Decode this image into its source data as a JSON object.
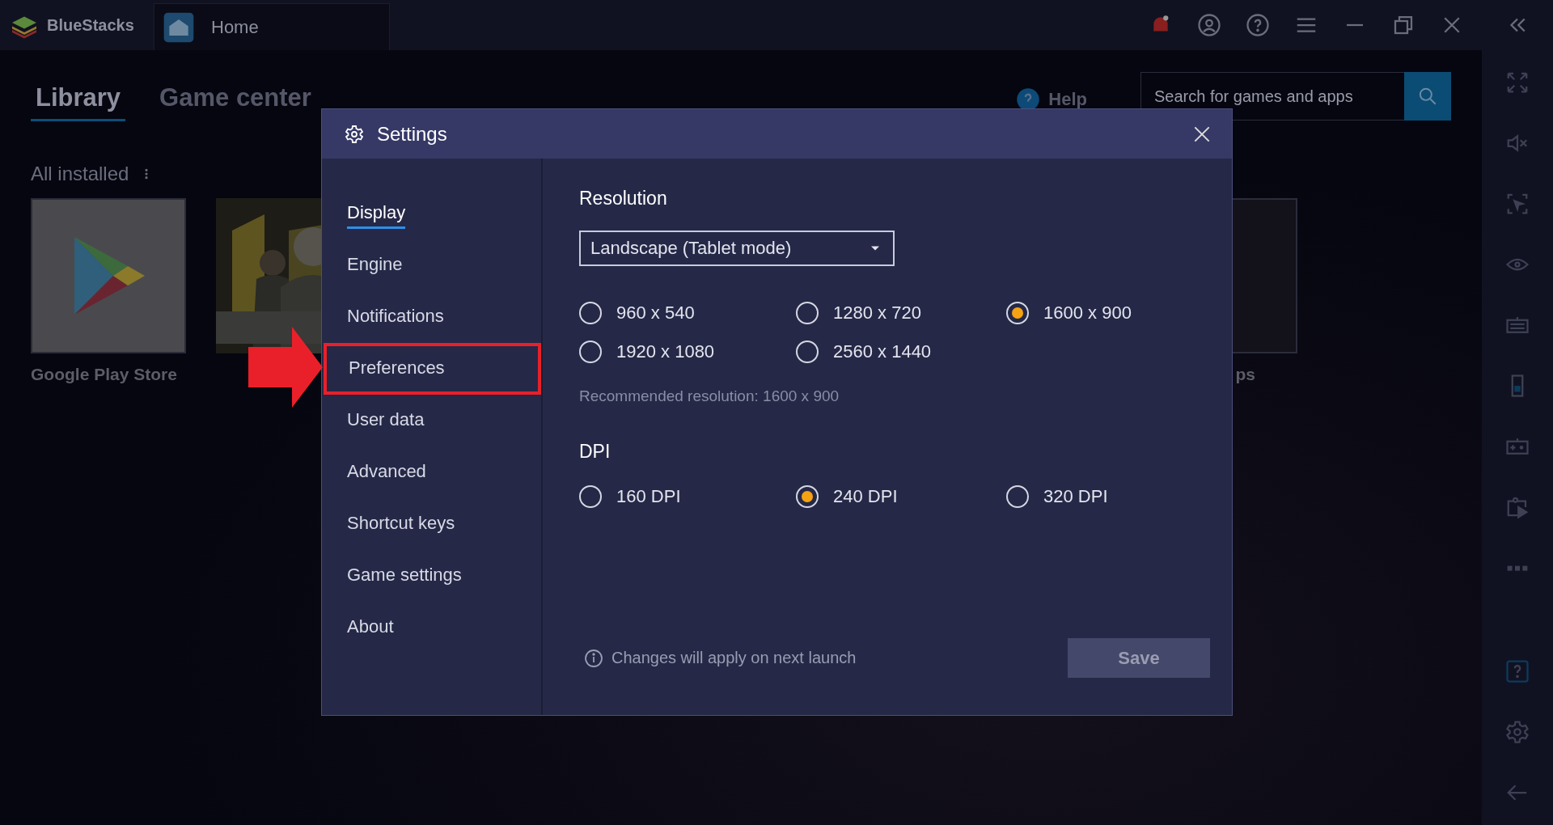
{
  "app": {
    "name": "BlueStacks"
  },
  "tabs": [
    {
      "label": "Home",
      "selected": true
    }
  ],
  "library": {
    "tabs": [
      {
        "label": "Library",
        "selected": true
      },
      {
        "label": "Game center",
        "selected": false
      }
    ],
    "help": "Help",
    "search": {
      "placeholder": "Search for games and apps"
    },
    "section": "All installed",
    "apps": [
      {
        "kind": "play",
        "name": "Google Play Store"
      },
      {
        "kind": "picture"
      },
      {
        "kind": "system",
        "name": "ps"
      }
    ]
  },
  "settings": {
    "title": "Settings",
    "nav": [
      {
        "label": "Display",
        "selected": true,
        "annotated": false
      },
      {
        "label": "Engine",
        "selected": false,
        "annotated": false
      },
      {
        "label": "Notifications",
        "selected": false,
        "annotated": false
      },
      {
        "label": "Preferences",
        "selected": false,
        "annotated": true
      },
      {
        "label": "User data",
        "selected": false,
        "annotated": false
      },
      {
        "label": "Advanced",
        "selected": false,
        "annotated": false
      },
      {
        "label": "Shortcut keys",
        "selected": false,
        "annotated": false
      },
      {
        "label": "Game settings",
        "selected": false,
        "annotated": false
      },
      {
        "label": "About",
        "selected": false,
        "annotated": false
      }
    ],
    "resolution": {
      "heading": "Resolution",
      "mode": "Landscape (Tablet mode)",
      "options": [
        {
          "label": "960 x 540",
          "selected": false
        },
        {
          "label": "1280 x 720",
          "selected": false
        },
        {
          "label": "1600 x 900",
          "selected": true
        },
        {
          "label": "1920 x 1080",
          "selected": false
        },
        {
          "label": "2560 x 1440",
          "selected": false
        }
      ],
      "recommended": "Recommended resolution: 1600 x 900"
    },
    "dpi": {
      "heading": "DPI",
      "options": [
        {
          "label": "160 DPI",
          "selected": false
        },
        {
          "label": "240 DPI",
          "selected": true
        },
        {
          "label": "320 DPI",
          "selected": false
        }
      ]
    },
    "note": "Changes will apply on next launch",
    "save": "Save"
  }
}
